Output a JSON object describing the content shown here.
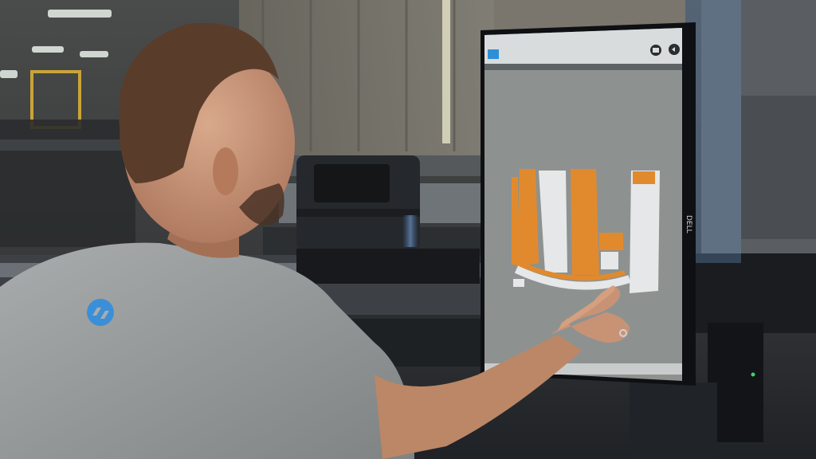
{
  "scene": {
    "description_tag": "",
    "monitor": {
      "brand": "DELL",
      "screen": {
        "app_name": "",
        "header_subtitle": "",
        "icons": [
          "mail-icon",
          "back-icon"
        ],
        "colors": {
          "screen_bg": "#8d9291",
          "header_bg": "#d9dcdc",
          "pattern_orange": "#e18a2d",
          "pattern_white": "#e6e7e8",
          "accent_blue": "#2f8fd6"
        }
      }
    },
    "shirt_logo_color": "#3b8fd8"
  }
}
